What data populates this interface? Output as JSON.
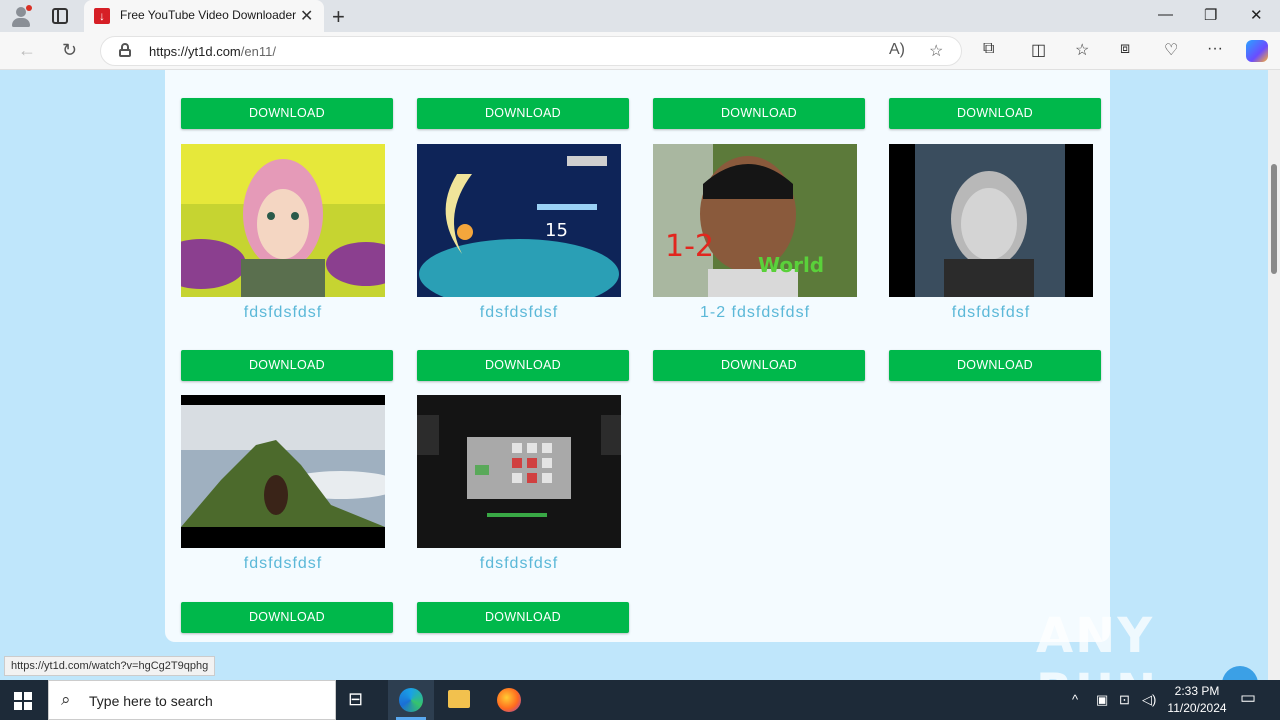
{
  "browser": {
    "tab_title": "Free YouTube Video Downloader",
    "tab_favicon": "download-arrow-icon",
    "url_host": "https://yt1d.com",
    "url_path": "/en11/",
    "status_url": "https://yt1d.com/watch?v=hgCg2T9qphg"
  },
  "page": {
    "download_label": "DOWNLOAD",
    "videos": [
      {
        "title": "fdsfdsfdsf"
      },
      {
        "title": "fdsfdsfdsf"
      },
      {
        "title": "1-2 fdsfdsfdsf"
      },
      {
        "title": "fdsfdsfdsf"
      },
      {
        "title": "fdsfdsfdsf"
      },
      {
        "title": "fdsfdsfdsf"
      }
    ]
  },
  "watermark": "ANY RUN",
  "taskbar": {
    "search_placeholder": "Type here to search",
    "time": "2:33 PM",
    "date": "11/20/2024"
  },
  "colors": {
    "download_button": "#00b84b",
    "caption": "#5bb8d8",
    "page_background": "#bfe6fb"
  }
}
